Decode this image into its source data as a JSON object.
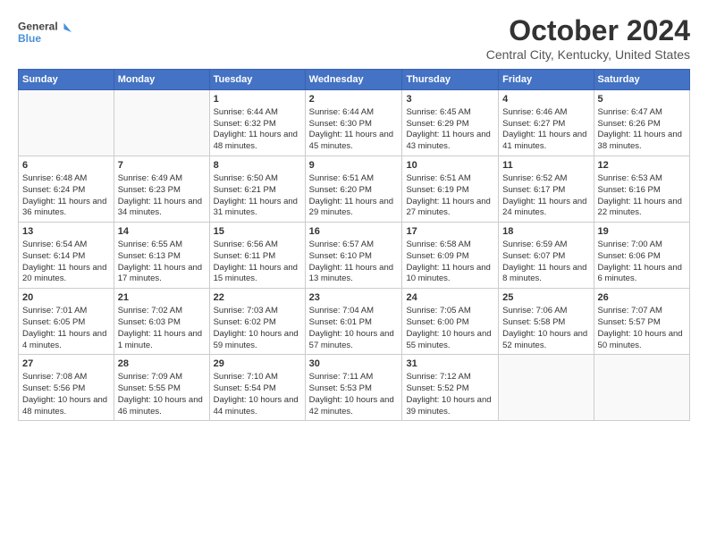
{
  "logo": {
    "line1": "General",
    "line2": "Blue"
  },
  "title": "October 2024",
  "location": "Central City, Kentucky, United States",
  "weekdays": [
    "Sunday",
    "Monday",
    "Tuesday",
    "Wednesday",
    "Thursday",
    "Friday",
    "Saturday"
  ],
  "weeks": [
    [
      {
        "day": "",
        "info": ""
      },
      {
        "day": "",
        "info": ""
      },
      {
        "day": "1",
        "info": "Sunrise: 6:44 AM\nSunset: 6:32 PM\nDaylight: 11 hours and 48 minutes."
      },
      {
        "day": "2",
        "info": "Sunrise: 6:44 AM\nSunset: 6:30 PM\nDaylight: 11 hours and 45 minutes."
      },
      {
        "day": "3",
        "info": "Sunrise: 6:45 AM\nSunset: 6:29 PM\nDaylight: 11 hours and 43 minutes."
      },
      {
        "day": "4",
        "info": "Sunrise: 6:46 AM\nSunset: 6:27 PM\nDaylight: 11 hours and 41 minutes."
      },
      {
        "day": "5",
        "info": "Sunrise: 6:47 AM\nSunset: 6:26 PM\nDaylight: 11 hours and 38 minutes."
      }
    ],
    [
      {
        "day": "6",
        "info": "Sunrise: 6:48 AM\nSunset: 6:24 PM\nDaylight: 11 hours and 36 minutes."
      },
      {
        "day": "7",
        "info": "Sunrise: 6:49 AM\nSunset: 6:23 PM\nDaylight: 11 hours and 34 minutes."
      },
      {
        "day": "8",
        "info": "Sunrise: 6:50 AM\nSunset: 6:21 PM\nDaylight: 11 hours and 31 minutes."
      },
      {
        "day": "9",
        "info": "Sunrise: 6:51 AM\nSunset: 6:20 PM\nDaylight: 11 hours and 29 minutes."
      },
      {
        "day": "10",
        "info": "Sunrise: 6:51 AM\nSunset: 6:19 PM\nDaylight: 11 hours and 27 minutes."
      },
      {
        "day": "11",
        "info": "Sunrise: 6:52 AM\nSunset: 6:17 PM\nDaylight: 11 hours and 24 minutes."
      },
      {
        "day": "12",
        "info": "Sunrise: 6:53 AM\nSunset: 6:16 PM\nDaylight: 11 hours and 22 minutes."
      }
    ],
    [
      {
        "day": "13",
        "info": "Sunrise: 6:54 AM\nSunset: 6:14 PM\nDaylight: 11 hours and 20 minutes."
      },
      {
        "day": "14",
        "info": "Sunrise: 6:55 AM\nSunset: 6:13 PM\nDaylight: 11 hours and 17 minutes."
      },
      {
        "day": "15",
        "info": "Sunrise: 6:56 AM\nSunset: 6:11 PM\nDaylight: 11 hours and 15 minutes."
      },
      {
        "day": "16",
        "info": "Sunrise: 6:57 AM\nSunset: 6:10 PM\nDaylight: 11 hours and 13 minutes."
      },
      {
        "day": "17",
        "info": "Sunrise: 6:58 AM\nSunset: 6:09 PM\nDaylight: 11 hours and 10 minutes."
      },
      {
        "day": "18",
        "info": "Sunrise: 6:59 AM\nSunset: 6:07 PM\nDaylight: 11 hours and 8 minutes."
      },
      {
        "day": "19",
        "info": "Sunrise: 7:00 AM\nSunset: 6:06 PM\nDaylight: 11 hours and 6 minutes."
      }
    ],
    [
      {
        "day": "20",
        "info": "Sunrise: 7:01 AM\nSunset: 6:05 PM\nDaylight: 11 hours and 4 minutes."
      },
      {
        "day": "21",
        "info": "Sunrise: 7:02 AM\nSunset: 6:03 PM\nDaylight: 11 hours and 1 minute."
      },
      {
        "day": "22",
        "info": "Sunrise: 7:03 AM\nSunset: 6:02 PM\nDaylight: 10 hours and 59 minutes."
      },
      {
        "day": "23",
        "info": "Sunrise: 7:04 AM\nSunset: 6:01 PM\nDaylight: 10 hours and 57 minutes."
      },
      {
        "day": "24",
        "info": "Sunrise: 7:05 AM\nSunset: 6:00 PM\nDaylight: 10 hours and 55 minutes."
      },
      {
        "day": "25",
        "info": "Sunrise: 7:06 AM\nSunset: 5:58 PM\nDaylight: 10 hours and 52 minutes."
      },
      {
        "day": "26",
        "info": "Sunrise: 7:07 AM\nSunset: 5:57 PM\nDaylight: 10 hours and 50 minutes."
      }
    ],
    [
      {
        "day": "27",
        "info": "Sunrise: 7:08 AM\nSunset: 5:56 PM\nDaylight: 10 hours and 48 minutes."
      },
      {
        "day": "28",
        "info": "Sunrise: 7:09 AM\nSunset: 5:55 PM\nDaylight: 10 hours and 46 minutes."
      },
      {
        "day": "29",
        "info": "Sunrise: 7:10 AM\nSunset: 5:54 PM\nDaylight: 10 hours and 44 minutes."
      },
      {
        "day": "30",
        "info": "Sunrise: 7:11 AM\nSunset: 5:53 PM\nDaylight: 10 hours and 42 minutes."
      },
      {
        "day": "31",
        "info": "Sunrise: 7:12 AM\nSunset: 5:52 PM\nDaylight: 10 hours and 39 minutes."
      },
      {
        "day": "",
        "info": ""
      },
      {
        "day": "",
        "info": ""
      }
    ]
  ]
}
